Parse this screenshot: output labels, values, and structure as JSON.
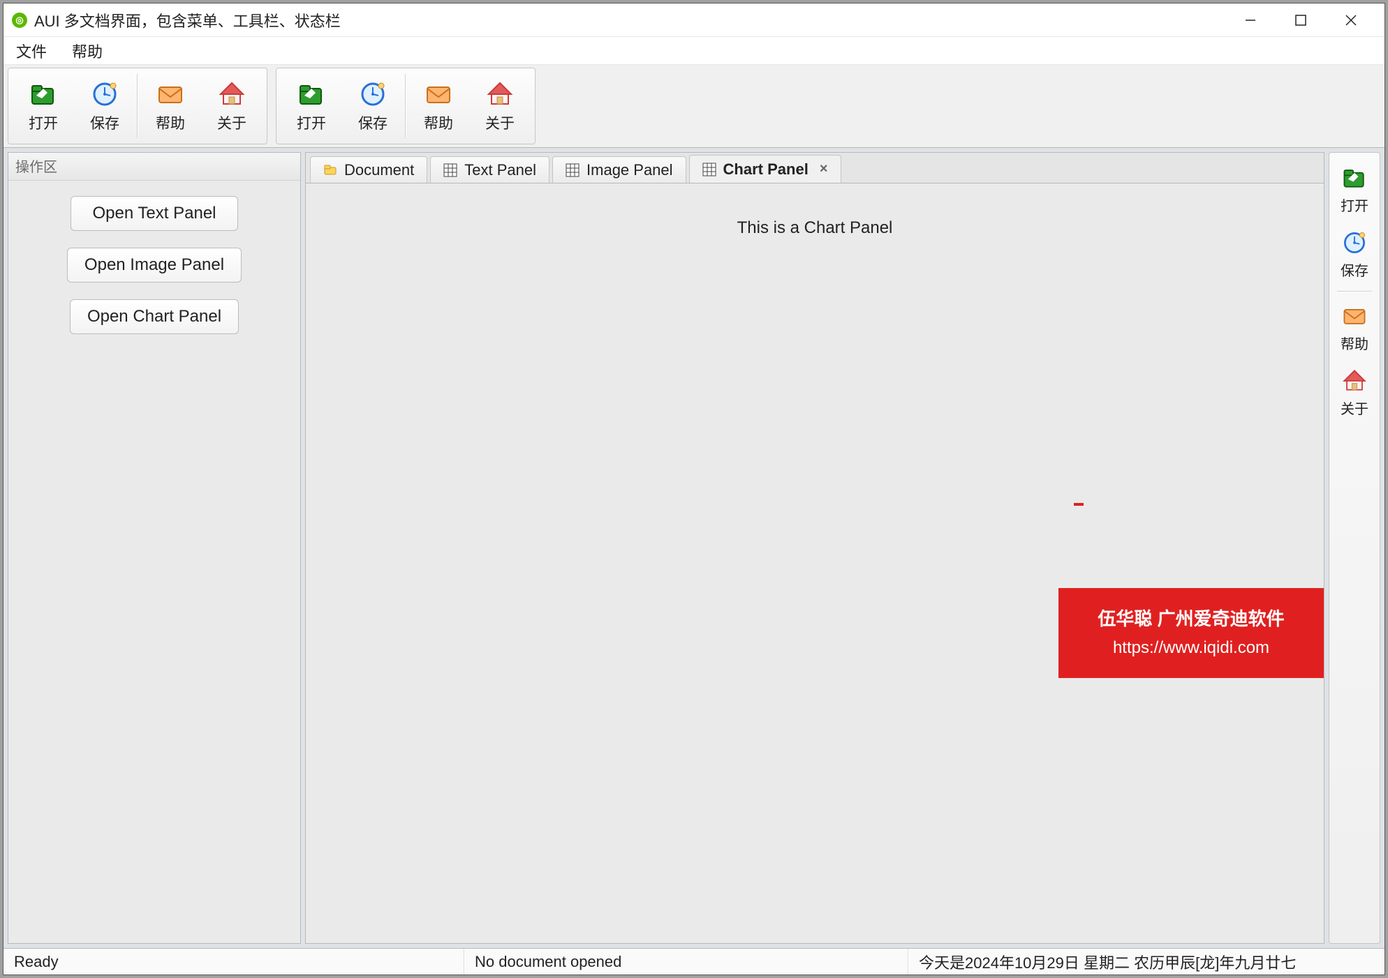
{
  "title": "AUI 多文档界面，包含菜单、工具栏、状态栏",
  "menu": {
    "file": "文件",
    "help": "帮助"
  },
  "toolbar": {
    "open": "打开",
    "save": "保存",
    "help": "帮助",
    "about": "关于"
  },
  "sidebar": {
    "title": "操作区",
    "btn_text": "Open Text Panel",
    "btn_image": "Open Image Panel",
    "btn_chart": "Open Chart Panel"
  },
  "tabs": {
    "document": "Document",
    "text": "Text Panel",
    "image": "Image Panel",
    "chart": "Chart Panel"
  },
  "content": {
    "chart_text": "This is a Chart Panel"
  },
  "watermark": {
    "line1": "伍华聪 广州爱奇迪软件",
    "url": "https://www.iqidi.com"
  },
  "status": {
    "ready": "Ready",
    "doc": "No document opened",
    "date": "今天是2024年10月29日 星期二 农历甲辰[龙]年九月廿七"
  }
}
